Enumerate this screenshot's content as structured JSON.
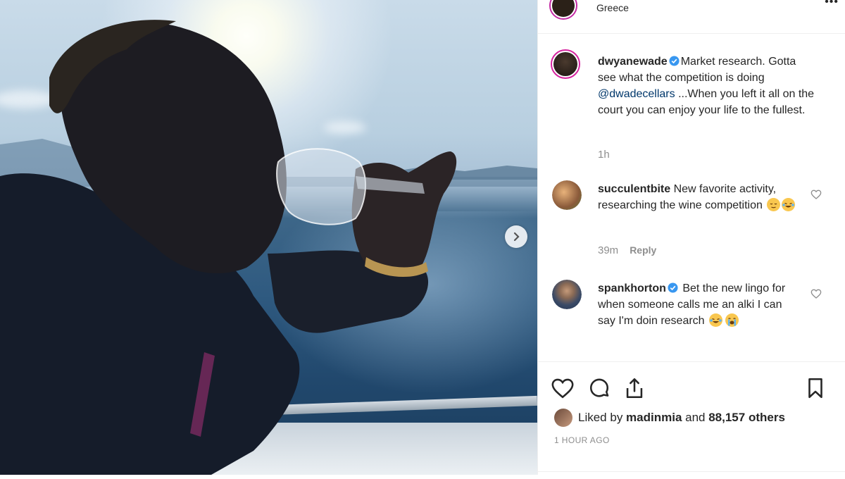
{
  "post": {
    "location": "Greece",
    "caption": {
      "username": "dwyanewade",
      "text_before_mention": "Market research. Gotta see what the competition is doing ",
      "mention": "@dwadecellars",
      "text_after_mention": " ...When you left it all on the court you can enjoy your life to the fullest.",
      "age": "1h"
    },
    "comments": [
      {
        "username": "succulentbite",
        "text": "New favorite activity, researching the wine competition",
        "age": "39m",
        "reply_label": "Reply"
      },
      {
        "username": "spankhorton",
        "text": "Bet the new lingo for when someone calls me an alki I can say I'm doin research"
      }
    ],
    "likes": {
      "prefix": "Liked by ",
      "user": "madinmia",
      "middle": " and ",
      "count": "88,157 others"
    },
    "timestamp": "1 HOUR AGO"
  },
  "colors": {
    "accent_link": "#00376b",
    "verified": "#3897f0",
    "muted": "#8e8e8e"
  }
}
